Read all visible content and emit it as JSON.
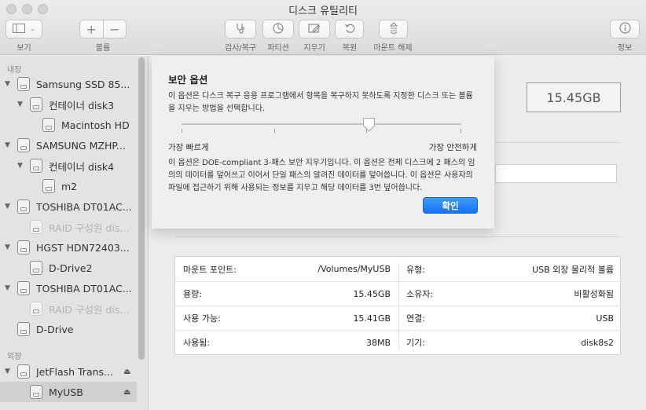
{
  "window": {
    "title": "디스크 유틸리티"
  },
  "toolbar": {
    "view_label": "보기",
    "volume_label": "볼륨",
    "add_symbol": "+",
    "remove_symbol": "−",
    "first_aid_label": "검사/복구",
    "partition_label": "파티션",
    "erase_label": "지우기",
    "restore_label": "복원",
    "unmount_label": "마운트 해제",
    "info_label": "정보"
  },
  "sidebar": {
    "internal_header": "내장",
    "external_header": "외장",
    "items": [
      {
        "label": "Samsung SSD 85...",
        "level": 0,
        "expanded": true
      },
      {
        "label": "컨테이너 disk3",
        "level": 1,
        "expanded": true
      },
      {
        "label": "Macintosh HD",
        "level": 2
      },
      {
        "label": "SAMSUNG MZHP...",
        "level": 0,
        "expanded": true
      },
      {
        "label": "컨테이너 disk4",
        "level": 1,
        "expanded": true
      },
      {
        "label": "m2",
        "level": 2
      },
      {
        "label": "TOSHIBA DT01AC...",
        "level": 0,
        "expanded": true
      },
      {
        "label": "RAID 구성원 disk...",
        "level": 1,
        "dim": true
      },
      {
        "label": "HGST HDN72403...",
        "level": 0,
        "expanded": true
      },
      {
        "label": "D-Drive2",
        "level": 1
      },
      {
        "label": "TOSHIBA DT01AC...",
        "level": 0,
        "expanded": true
      },
      {
        "label": "RAID 구성원 disk...",
        "level": 1,
        "dim": true
      },
      {
        "label": "D-Drive",
        "level": 0
      }
    ],
    "external_items": [
      {
        "label": "JetFlash Trans...",
        "level": 0,
        "expanded": true
      },
      {
        "label": "MyUSB",
        "level": 1,
        "selected": true
      }
    ]
  },
  "main": {
    "capacity": "15.45GB",
    "info_left": [
      {
        "key": "마운트 포인트:",
        "value": "/Volumes/MyUSB"
      },
      {
        "key": "용량:",
        "value": "15.45GB"
      },
      {
        "key": "사용 가능:",
        "value": "15.41GB"
      },
      {
        "key": "사용됨:",
        "value": "38MB"
      }
    ],
    "info_right": [
      {
        "key": "유형:",
        "value": "USB 외장 물리적 볼륨"
      },
      {
        "key": "소유자:",
        "value": "비활성화됨"
      },
      {
        "key": "연결:",
        "value": "USB"
      },
      {
        "key": "기기:",
        "value": "disk8s2"
      }
    ]
  },
  "sheet": {
    "title": "보안 옵션",
    "description": "이 옵션은 디스크 복구 응용 프로그램에서 항목을 복구하지 못하도록 지정한 디스크 또는 볼륨을 지우는 방법을 선택합니다.",
    "slider_min_label": "가장 빠르게",
    "slider_max_label": "가장 안전하게",
    "slider_position": 0.67,
    "detail": "이 옵션은 DOE-compliant 3-패스 보안 지우기입니다. 이 옵션은 전체 디스크에 2 패스의 임의의 데이터를 덮어쓰고 이어서 단일 패스의 알려진 데이터를 덮어씁니다. 이 옵션은 사용자의 파일에 접근하기 위해 사용되는 정보를 지우고 해당 데이터를 3번 덮어씁니다.",
    "ok_label": "확인"
  }
}
